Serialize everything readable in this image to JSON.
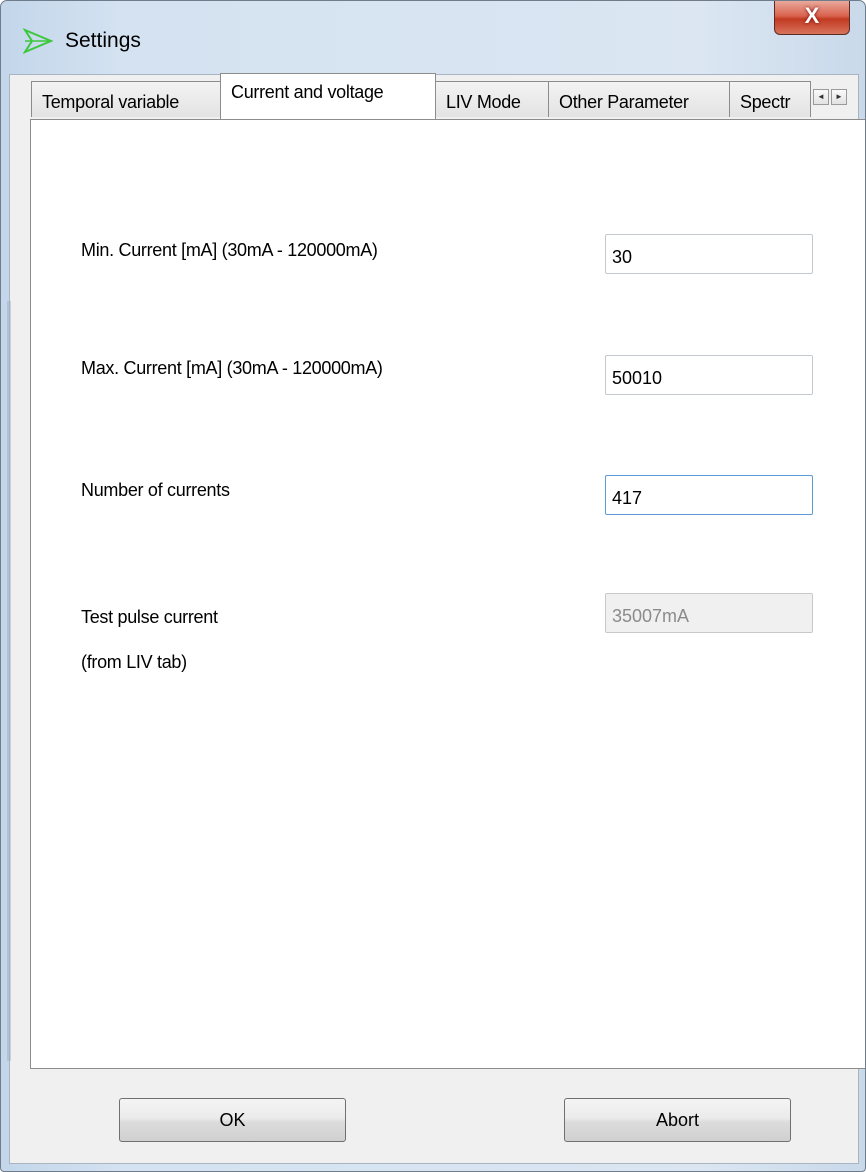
{
  "window": {
    "title": "Settings",
    "close_glyph": "X",
    "app_icon": "app-arrow-icon"
  },
  "tabs": [
    {
      "label": "Temporal variable"
    },
    {
      "label": "Current and voltage",
      "active": true
    },
    {
      "label": "LIV Mode"
    },
    {
      "label": "Other Parameter"
    },
    {
      "label": "Spectr"
    }
  ],
  "tab_scroll": {
    "left": "◄",
    "right": "►"
  },
  "form": {
    "min_current": {
      "label": "Min. Current [mA]  (30mA - 120000mA)",
      "value": "30"
    },
    "max_current": {
      "label": "Max. Current [mA]  (30mA - 120000mA)",
      "value": "50010"
    },
    "num_currents": {
      "label": "Number of currents",
      "value": "417"
    },
    "test_pulse": {
      "label": "Test pulse current",
      "sublabel": "(from LIV tab)",
      "value": "35007mA"
    }
  },
  "buttons": {
    "ok": "OK",
    "abort": "Abort"
  },
  "colors": {
    "focus_border": "#5d9ad8",
    "close_red": "#c23a22",
    "icon_green": "#3cc83c"
  }
}
